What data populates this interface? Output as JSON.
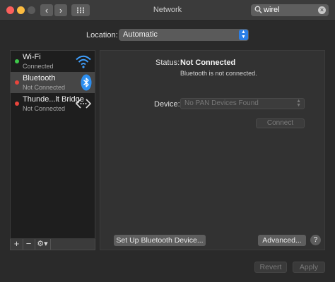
{
  "window": {
    "title": "Network"
  },
  "search": {
    "value": "wirel"
  },
  "location": {
    "label": "Location:",
    "value": "Automatic"
  },
  "services": [
    {
      "name": "Wi-Fi",
      "status": "Connected",
      "state": "green",
      "icon": "wifi-icon"
    },
    {
      "name": "Bluetooth",
      "status": "Not Connected",
      "state": "red",
      "icon": "bluetooth-icon"
    },
    {
      "name": "Thunde...lt Bridge",
      "status": "Not Connected",
      "state": "red",
      "icon": "thunderbolt-bridge-icon"
    }
  ],
  "sidebar_buttons": {
    "add": "+",
    "remove": "−",
    "action": "⚙▾"
  },
  "detail": {
    "status_label": "Status:",
    "status_value": "Not Connected",
    "status_desc": "Bluetooth is not connected.",
    "device_label": "Device:",
    "device_value": "No PAN Devices Found",
    "connect_label": "Connect",
    "setup_label": "Set Up Bluetooth Device...",
    "advanced_label": "Advanced...",
    "help_label": "?"
  },
  "footer": {
    "revert_label": "Revert",
    "apply_label": "Apply"
  },
  "colors": {
    "accent": "#2c7fe5",
    "connected": "#3ec84a",
    "disconnected": "#e8453c"
  }
}
